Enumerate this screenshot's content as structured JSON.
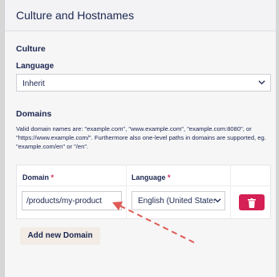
{
  "header": {
    "title": "Culture and Hostnames"
  },
  "culture": {
    "section_label": "Culture",
    "language_label": "Language",
    "language_value": "Inherit"
  },
  "domains": {
    "section_label": "Domains",
    "description": "Valid domain names are: \"example.com\", \"www.example.com\", \"example.com:8080\", or \"https://www.example.com/\". Furthermore also one-level paths in domains are supported, eg. \"example.com/en\" or \"/en\".",
    "columns": [
      {
        "label": "Domain",
        "required_mark": "*"
      },
      {
        "label": "Language",
        "required_mark": "*"
      }
    ],
    "rows": [
      {
        "domain": "/products/my-product",
        "language": "English (United States)"
      }
    ],
    "add_label": "Add new Domain"
  },
  "icons": {
    "chevron": "chevron-down-icon",
    "delete": "trash-icon"
  },
  "colors": {
    "accent_red": "#d42054",
    "text": "#1b264f",
    "annotation_arrow": "#e05a55"
  }
}
